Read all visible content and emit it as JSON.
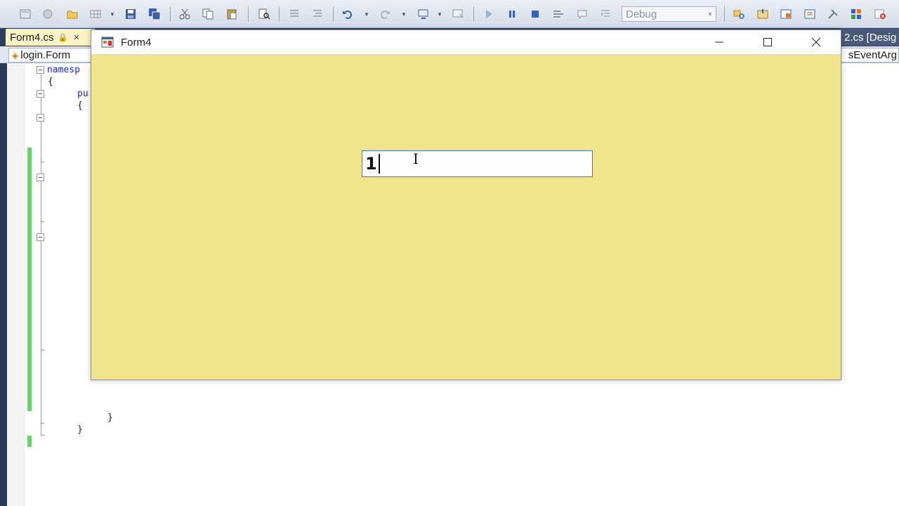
{
  "toolbar": {
    "config_value": "Debug",
    "icons": [
      "layout-icon",
      "circle-icon",
      "open-folder-icon",
      "grid-icon",
      "save-icon",
      "save-all-icon",
      "cut-icon",
      "copy-icon",
      "paste-icon",
      "find-icon",
      "comment-icon",
      "uncomment-icon",
      "undo-icon",
      "redo-icon",
      "navigate-icon",
      "screen-icon",
      "start-icon",
      "pause-icon",
      "stop-icon",
      "step-icon",
      "breakpoint-icon",
      "indent-icon",
      "solution-explorer-icon",
      "properties-icon",
      "object-browser-icon",
      "toolbox-icon",
      "tools-icon",
      "extension-icon",
      "close-red-icon"
    ]
  },
  "tabs": {
    "active_tab": "Form4.cs",
    "right_tab": "2.cs [Desig"
  },
  "navigation": {
    "left_combo": "login.Form",
    "right_combo": "sEventArg"
  },
  "code": {
    "line1_keyword": "namesp",
    "line2": "{",
    "line3_keyword": "pu",
    "line4": "{",
    "close1": "}",
    "close2": "}"
  },
  "form4": {
    "title": "Form4",
    "textbox_value": "1",
    "back_color": "#efe48b"
  },
  "colors": {
    "accent_border": "#3c7fc0",
    "change_bar": "#66d46a",
    "keyword": "#1f28d0"
  }
}
